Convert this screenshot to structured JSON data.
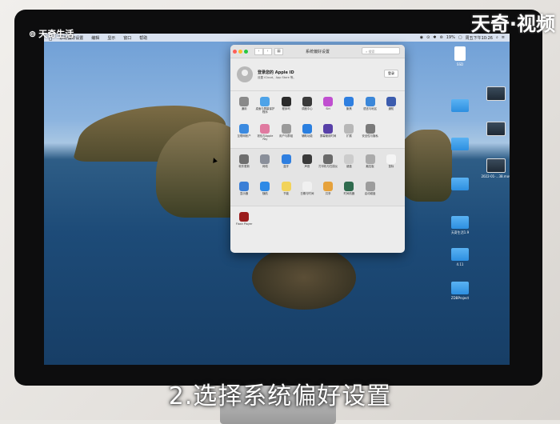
{
  "watermark": {
    "top_left": "天奇生活",
    "top_right": "天奇·视频"
  },
  "caption": "2.选择系统偏好设置",
  "menubar": {
    "apple": "",
    "items": [
      "系统偏好设置",
      "编辑",
      "显示",
      "窗口",
      "帮助"
    ],
    "status": [
      "◉",
      "⊙",
      "✱",
      "⊜",
      "19%",
      "▢",
      "周五下午10:26",
      "⌕",
      "≡"
    ]
  },
  "window": {
    "title": "系统偏好设置",
    "search_placeholder": "搜索",
    "account": {
      "title": "登录您的 Apple ID",
      "subtitle": "设置 iCloud、App Store 等。",
      "button": "登录"
    },
    "row1": [
      {
        "label": "通用",
        "color": "#8a8a8a"
      },
      {
        "label": "桌面与屏幕保护程序",
        "color": "#4ea3e8"
      },
      {
        "label": "程序坞",
        "color": "#2b2b2b"
      },
      {
        "label": "调度中心",
        "color": "#3a3a3a"
      },
      {
        "label": "Siri",
        "color": "#c04fd0"
      },
      {
        "label": "聚焦",
        "color": "#2f7fe0"
      },
      {
        "label": "语言与地区",
        "color": "#3b87d9"
      },
      {
        "label": "通知",
        "color": "#3c5cae"
      }
    ],
    "row2": [
      {
        "label": "互联网帐户",
        "color": "#3b8ae0"
      },
      {
        "label": "钱包与Apple Pay",
        "color": "#e07aa0"
      },
      {
        "label": "用户与群组",
        "color": "#9a9a9a"
      },
      {
        "label": "辅助功能",
        "color": "#2a7fe0"
      },
      {
        "label": "屏幕使用时间",
        "color": "#5840a8"
      },
      {
        "label": "扩展",
        "color": "#b7b7b7"
      },
      {
        "label": "安全性与隐私",
        "color": "#7a7a7a"
      }
    ],
    "row3": [
      {
        "label": "软件更新",
        "color": "#6e6e6e"
      },
      {
        "label": "网络",
        "color": "#8a8f9a"
      },
      {
        "label": "蓝牙",
        "color": "#2f7fe0"
      },
      {
        "label": "声音",
        "color": "#3a3a3a"
      },
      {
        "label": "打印机与扫描仪",
        "color": "#6a6a6a"
      },
      {
        "label": "键盘",
        "color": "#cccccc"
      },
      {
        "label": "触控板",
        "color": "#aaaaaa"
      },
      {
        "label": "鼠标",
        "color": "#f4f4f4"
      }
    ],
    "row4": [
      {
        "label": "显示器",
        "color": "#3b7fd6"
      },
      {
        "label": "随航",
        "color": "#2e8ae6"
      },
      {
        "label": "节能",
        "color": "#f2d35a"
      },
      {
        "label": "日期与时间",
        "color": "#f0f0f0"
      },
      {
        "label": "共享",
        "color": "#e6a23c"
      },
      {
        "label": "时间机器",
        "color": "#2f6b4e"
      },
      {
        "label": "启动磁盘",
        "color": "#9c9c9c"
      }
    ],
    "row5": [
      {
        "label": "Flash Player",
        "color": "#9b1c1c"
      }
    ]
  },
  "desktop": [
    {
      "label": "SSD",
      "kind": "file"
    },
    {
      "label": "",
      "kind": "thumb"
    },
    {
      "label": "",
      "kind": "folder"
    },
    {
      "label": "",
      "kind": "thumb"
    },
    {
      "label": "",
      "kind": "folder"
    },
    {
      "label": "2022-01-...38.mov",
      "kind": "thumb"
    },
    {
      "label": "",
      "kind": "folder"
    },
    {
      "label": "天奇生活1.9",
      "kind": "folder"
    },
    {
      "label": "4.11",
      "kind": "folder"
    },
    {
      "label": "ZDBProject",
      "kind": "folder"
    }
  ]
}
